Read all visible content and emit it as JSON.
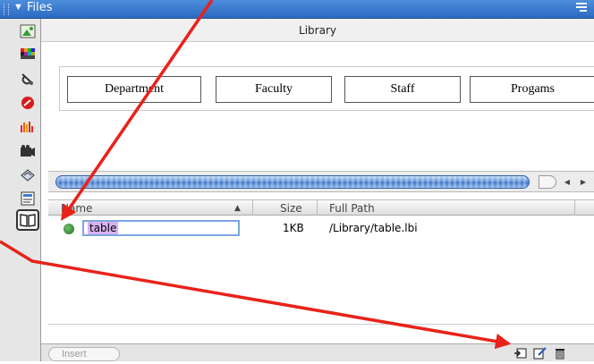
{
  "panel": {
    "title": "Files"
  },
  "preview": {
    "header": "Library",
    "nav_buttons": [
      "Department",
      "Faculty",
      "Staff",
      "Progams"
    ]
  },
  "list": {
    "columns": {
      "name": "Name",
      "size": "Size",
      "path": "Full Path"
    },
    "rows": [
      {
        "name": "table",
        "size": "1KB",
        "path": "/Library/table.lbi"
      }
    ]
  },
  "bottombar": {
    "insert_label": "Insert"
  },
  "icons": {
    "categories": [
      "images-icon",
      "colors-icon",
      "urls-icon",
      "flash-icon",
      "shockwave-icon",
      "movies-icon",
      "scripts-icon",
      "templates-icon",
      "library-icon"
    ],
    "tools": [
      "new-library-item-icon",
      "edit-icon",
      "delete-icon"
    ]
  },
  "colors": {
    "titlebar": "#3a7bd5",
    "annotation": "#e8221a",
    "selection": "#d8b2f0"
  }
}
